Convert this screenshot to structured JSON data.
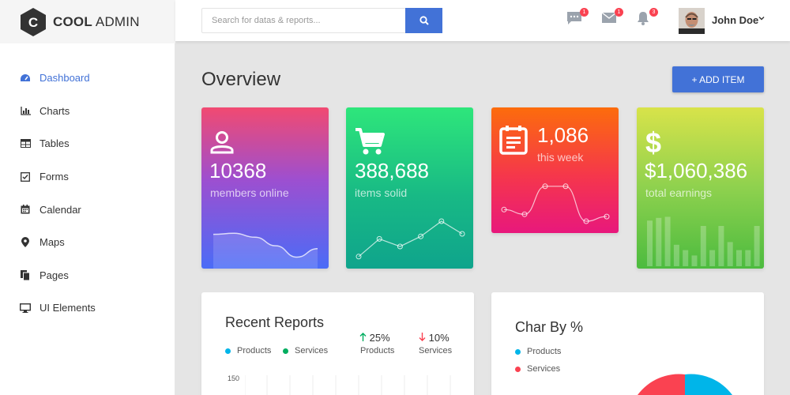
{
  "brand": {
    "name_bold": "COOL",
    "name_light": " ADMIN",
    "logo_letter": "C"
  },
  "header": {
    "search_placeholder": "Search for datas & reports...",
    "messages_badge": "1",
    "mail_badge": "1",
    "notifications_badge": "3",
    "user_name": "John Doe"
  },
  "sidebar": {
    "items": [
      {
        "label": "Dashboard",
        "icon": "dashboard-icon",
        "active": true
      },
      {
        "label": "Charts",
        "icon": "bar-chart-icon"
      },
      {
        "label": "Tables",
        "icon": "table-icon"
      },
      {
        "label": "Forms",
        "icon": "checkbox-icon"
      },
      {
        "label": "Calendar",
        "icon": "calendar-icon"
      },
      {
        "label": "Maps",
        "icon": "map-marker-icon"
      },
      {
        "label": "Pages",
        "icon": "copy-icon"
      },
      {
        "label": "UI Elements",
        "icon": "desktop-icon"
      }
    ]
  },
  "main": {
    "title": "Overview",
    "add_button": "+ ADD ITEM"
  },
  "cards": [
    {
      "value": "10368",
      "label": "members online",
      "icon": "user-icon",
      "color_top": "#f14a71",
      "color_bottom": "#4a6cf7"
    },
    {
      "value": "388,688",
      "label": "items solid",
      "icon": "cart-icon",
      "color_top": "#2ee67b",
      "color_bottom": "#0fa48c"
    },
    {
      "value": "1,086",
      "label": "this week",
      "icon": "calendar-note-icon",
      "color_top": "#fc6c0c",
      "color_bottom": "#e8187c"
    },
    {
      "value": "$1,060,386",
      "label": "total earnings",
      "icon": "dollar-icon",
      "color_top": "#d8e34a",
      "color_bottom": "#4cbb3f"
    }
  ],
  "recent_reports": {
    "title": "Recent Reports",
    "legend": [
      {
        "label": "Products",
        "color": "#00b5e9"
      },
      {
        "label": "Services",
        "color": "#00ad5f"
      }
    ],
    "stats": [
      {
        "value": "25%",
        "direction": "up",
        "label": "Products",
        "color": "#00ad5f"
      },
      {
        "value": "10%",
        "direction": "down",
        "label": "Services",
        "color": "#fa4251"
      }
    ],
    "y_tick_top": "150"
  },
  "char_by": {
    "title": "Char By %",
    "legend": [
      {
        "label": "Products",
        "color": "#00b5e9"
      },
      {
        "label": "Services",
        "color": "#fa4251"
      }
    ]
  },
  "chart_data": [
    {
      "type": "line",
      "title": "",
      "values": [
        60,
        62,
        55,
        40,
        20,
        35
      ]
    },
    {
      "type": "line",
      "title": "",
      "values": [
        5,
        40,
        25,
        45,
        75,
        50
      ]
    },
    {
      "type": "line",
      "title": "",
      "values": [
        30,
        20,
        80,
        80,
        5,
        15
      ]
    },
    {
      "type": "bar",
      "title": "",
      "values": [
        85,
        90,
        92,
        40,
        30,
        20,
        75,
        30,
        75,
        45,
        30,
        30,
        75
      ]
    }
  ]
}
